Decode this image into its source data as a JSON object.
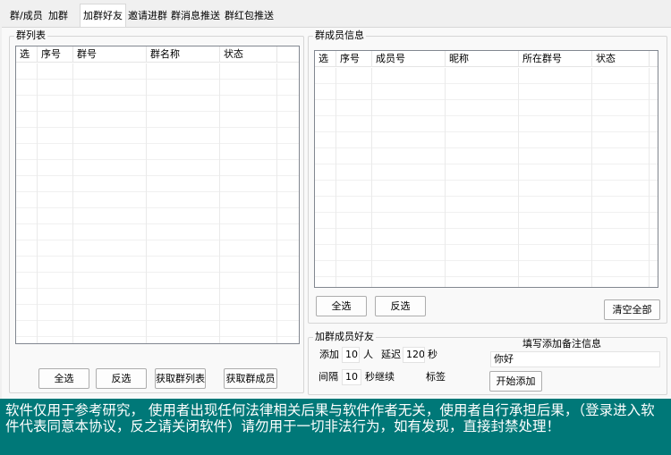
{
  "tabs": [
    {
      "label": "群/成员"
    },
    {
      "label": "加群"
    },
    {
      "label": "加群好友"
    },
    {
      "label": "邀请进群"
    },
    {
      "label": "群消息推送"
    },
    {
      "label": "群红包推送"
    }
  ],
  "group_list": {
    "title": "群列表",
    "columns": [
      "选",
      "序号",
      "群号",
      "群名称",
      "状态"
    ],
    "buttons": {
      "select_all": "全选",
      "invert": "反选",
      "fetch_groups": "获取群列表",
      "fetch_members": "获取群成员"
    }
  },
  "member_info": {
    "title": "群成员信息",
    "columns": [
      "选",
      "序号",
      "成员号",
      "昵称",
      "所在群号",
      "状态"
    ],
    "buttons": {
      "select_all": "全选",
      "invert": "反选",
      "clear_all": "清空全部"
    }
  },
  "add_friends": {
    "title": "加群成员好友",
    "add_label": "添加",
    "add_count": "10",
    "add_unit": "人",
    "delay_label": "延迟",
    "delay_value": "120",
    "delay_unit": "秒",
    "interval_label": "间隔",
    "interval_value": "10",
    "interval_unit": "秒继续",
    "tag_label": "标签",
    "remark_title": "填写添加备注信息",
    "remark_value": "你好",
    "start_button": "开始添加"
  },
  "footer": {
    "disclaimer": "软件仅用于参考研究， 使用者出现任何法律相关后果与软件作者无关，使用者自行承担后果，（登录进入软件代表同意本协议，反之请关闭软件）请勿用于一切非法行为，如有发现，直接封禁处理！"
  },
  "colors": {
    "footer_bg": "#007878",
    "footer_text": "#ffffff"
  }
}
